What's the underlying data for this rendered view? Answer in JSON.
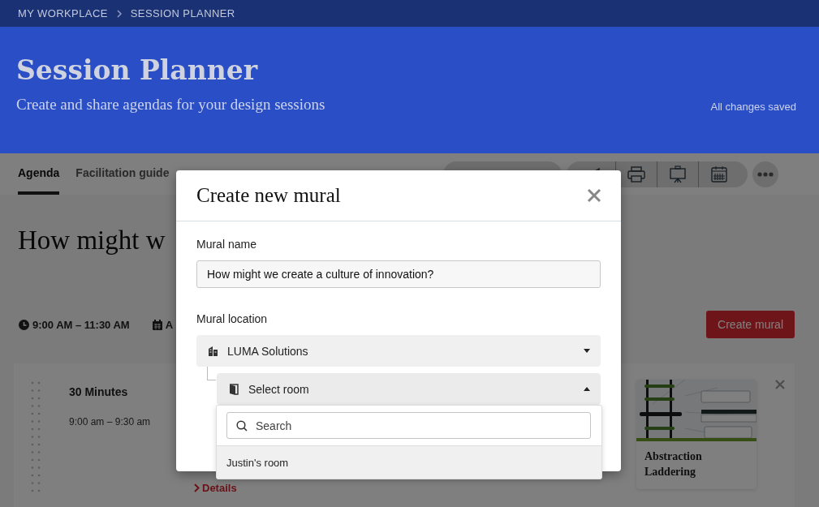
{
  "breadcrumb": [
    "MY WORKPLACE",
    "SESSION PLANNER"
  ],
  "header": {
    "title": "Session Planner",
    "subtitle": "Create and share agendas for your design sessions",
    "save_status": "All changes saved"
  },
  "tabs": [
    {
      "label": "Agenda",
      "selected": true
    },
    {
      "label": "Facilitation guide",
      "selected": false
    }
  ],
  "session": {
    "title": "How might w",
    "time": "9:00 AM – 11:30 AM",
    "date": "A",
    "create_button": "Create mural"
  },
  "agenda_item": {
    "duration": "30 Minutes",
    "time_range": "9:00 am – 9:30 am",
    "details_link": "Details",
    "method_card": {
      "kind": "picture",
      "title": "Abstraction Laddering"
    }
  },
  "modal": {
    "title": "Create new mural",
    "name_label": "Mural name",
    "name_value": "How might we create a culture of innovation?",
    "location_label": "Mural location",
    "workspace": "LUMA Solutions",
    "room_placeholder": "Select room",
    "room_expanded": true,
    "search": {
      "placeholder": "Search"
    },
    "options": [
      {
        "label": "Justin's room",
        "highlighted": true
      }
    ]
  }
}
